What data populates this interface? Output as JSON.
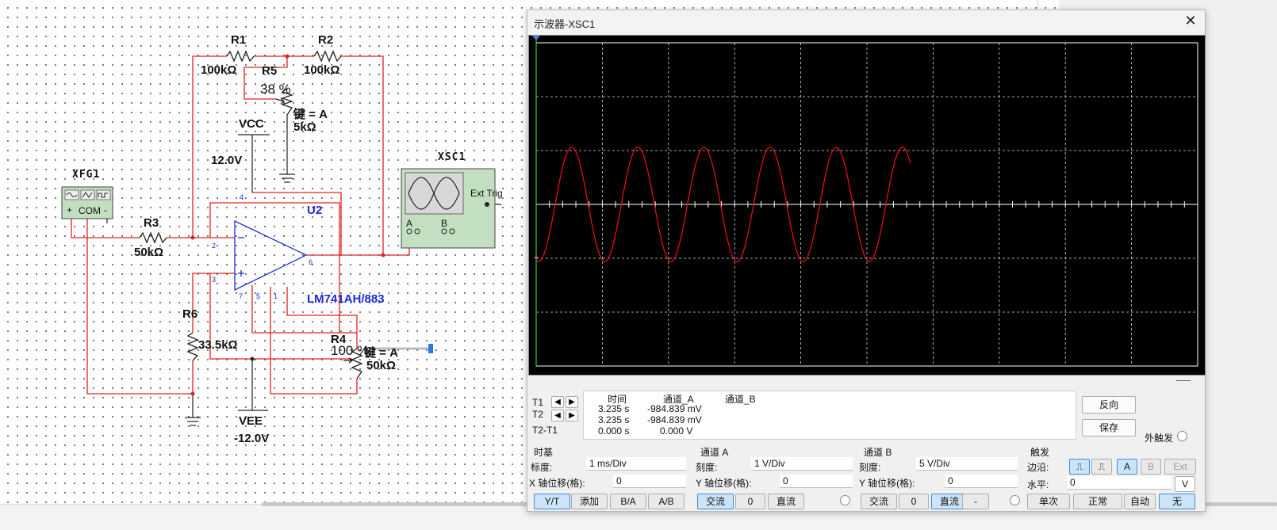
{
  "schematic": {
    "R1": {
      "name": "R1",
      "value": "100kΩ"
    },
    "R2": {
      "name": "R2",
      "value": "100kΩ"
    },
    "R5": {
      "name": "R5",
      "percent": "38 %",
      "key": "键 = A",
      "value": "5kΩ"
    },
    "VCC": {
      "name": "VCC",
      "voltage": "12.0V"
    },
    "XSC1": {
      "name": "XSC1",
      "ext_trig": "Ext Trig",
      "chan_a": "A",
      "chan_b": "B"
    },
    "XFG1": {
      "name": "XFG1",
      "com": "COM",
      "plus": "+",
      "minus": "-"
    },
    "R3": {
      "name": "R3",
      "value": "50kΩ"
    },
    "U2": {
      "name": "U2",
      "part": "LM741AH/883",
      "pins": [
        "4",
        "2",
        "3",
        "6",
        "7",
        "5",
        "1"
      ]
    },
    "R6": {
      "name": "R6",
      "value": "33.5kΩ"
    },
    "R4": {
      "name": "R4",
      "percent": "100 %",
      "key": "键 = A",
      "value": "50kΩ"
    },
    "VEE": {
      "name": "VEE",
      "voltage": "-12.0V"
    }
  },
  "scope": {
    "title": "示波器-XSC1",
    "close_icon": "close-icon",
    "colors": {
      "screen": "#000000",
      "grid": "#ffffff",
      "trace": "#e01010",
      "cursor": "#2ad62a"
    },
    "cursor_rows": [
      {
        "label": "T1",
        "time": "3.235 s",
        "chan_a": "-984.839 mV",
        "chan_b": ""
      },
      {
        "label": "T2",
        "time": "3.235 s",
        "chan_a": "-984.839 mV",
        "chan_b": ""
      },
      {
        "label": "T2-T1",
        "time": "0.000 s",
        "chan_a": "0.000 V",
        "chan_b": ""
      }
    ],
    "readout_headers": {
      "time": "时间",
      "chan_a": "通道_A",
      "chan_b": "通道_B"
    },
    "reverse_button": "反向",
    "save_button": "保存",
    "ext_trigger_label": "外触发",
    "timebase": {
      "title": "时基",
      "scale_label": "标度:",
      "scale_value": "1 ms/Div",
      "xpos_label": "X 轴位移(格):",
      "xpos_value": "0",
      "buttons": [
        "Y/T",
        "添加",
        "B/A",
        "A/B"
      ],
      "selected": "Y/T"
    },
    "channel_a": {
      "title": "通道 A",
      "scale_label": "刻度:",
      "scale_value": "1  V/Div",
      "ypos_label": "Y 轴位移(格):",
      "ypos_value": "0",
      "buttons": [
        "交流",
        "0",
        "直流"
      ],
      "selected": "交流"
    },
    "channel_b": {
      "title": "通道 B",
      "scale_label": "刻度:",
      "scale_value": "5  V/Div",
      "ypos_label": "Y 轴位移(格):",
      "ypos_value": "0",
      "buttons": [
        "交流",
        "0",
        "直流",
        "-"
      ],
      "selected": "直流"
    },
    "trigger": {
      "title": "触发",
      "edge_label": "边沿:",
      "edge_buttons": [
        "rising-edge-icon",
        "falling-edge-icon",
        "A",
        "B",
        "Ext"
      ],
      "edge_selected": [
        "rising-edge-icon",
        "A"
      ],
      "level_label": "水平:",
      "level_value": "0",
      "level_unit": "V",
      "mode_buttons": [
        "单次",
        "正常",
        "自动",
        "无"
      ],
      "mode_selected": "无"
    }
  }
}
